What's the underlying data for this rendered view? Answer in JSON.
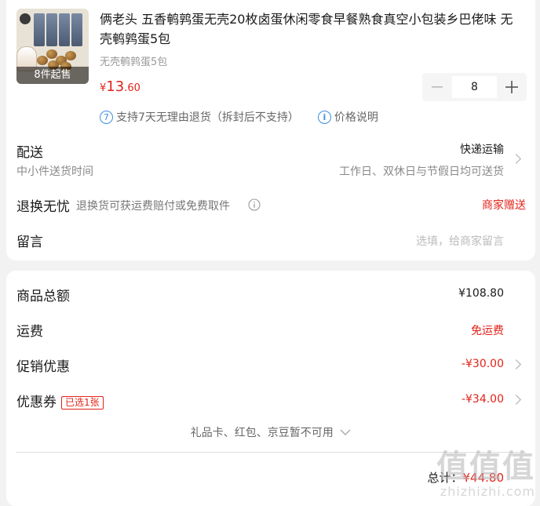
{
  "product": {
    "title": "俩老头 五香鹌鹑蛋无壳20枚卤蛋休闲零食早餐熟食真空小包装乡巴佬味 无壳鹌鹑蛋5包",
    "spec": "无壳鹌鹑蛋5包",
    "min_qty_badge": "8件起售",
    "price_symbol": "¥",
    "price_int": "13",
    "price_dec": ".60",
    "quantity": "8",
    "service_icon_num": "7",
    "service_return": "支持7天无理由退货（拆封后不支持）",
    "service_price_note": "价格说明"
  },
  "delivery": {
    "label": "配送",
    "sub": "中小件送货时间",
    "method": "快递运输",
    "time": "工作日、双休日与节假日均可送货"
  },
  "return_worry": {
    "label": "退换无忧",
    "desc": "退换货可获运费赔付或免费取件",
    "value": "商家赠送"
  },
  "message": {
    "label": "留言",
    "placeholder": "选填，给商家留言"
  },
  "summary": {
    "goods_total_label": "商品总额",
    "goods_total_value": "¥108.80",
    "shipping_label": "运费",
    "shipping_value": "免运费",
    "promo_label": "促销优惠",
    "promo_value": "-¥30.00",
    "coupon_label": "优惠券",
    "coupon_tag": "已选1张",
    "coupon_value": "-¥34.00",
    "gift_note": "礼品卡、红包、京豆暂不可用",
    "total_label": "总计：",
    "total_value": "¥44.80"
  },
  "watermark": {
    "big": "值值值",
    "small": "zhizhizhi.com"
  },
  "colors": {
    "accent": "#e2231a",
    "info_blue": "#3d8fe0"
  }
}
